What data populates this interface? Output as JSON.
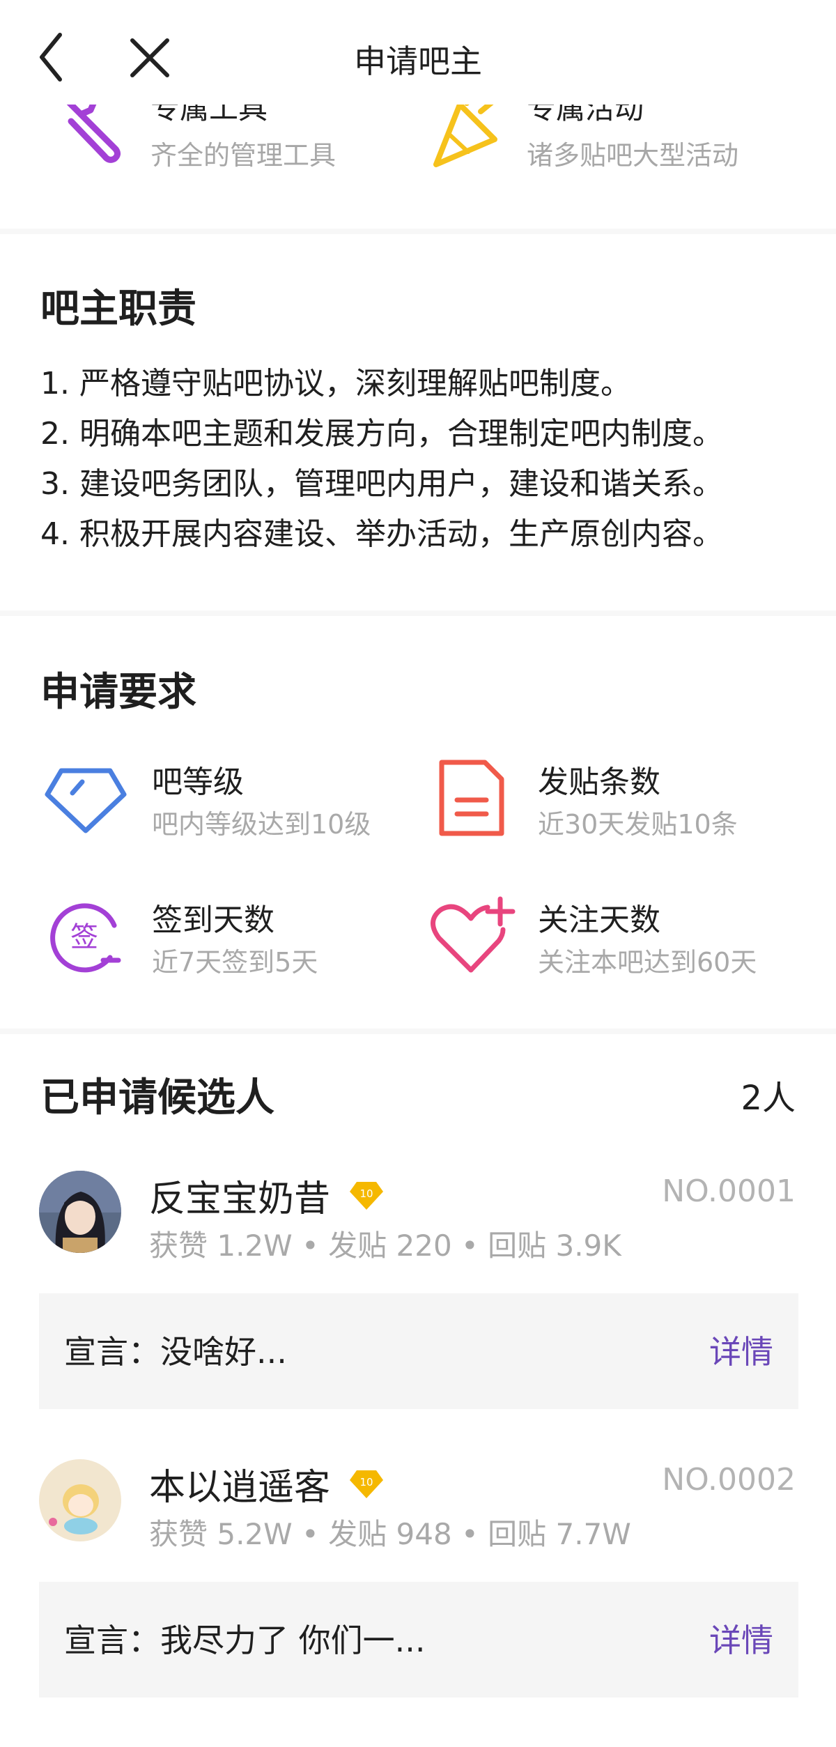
{
  "header": {
    "title": "申请吧主"
  },
  "perks": [
    {
      "title": "专属工具",
      "subtitle": "齐全的管理工具",
      "icon": "wrench-icon"
    },
    {
      "title": "专属活动",
      "subtitle": "诸多贴吧大型活动",
      "icon": "party-popper-icon"
    }
  ],
  "duties": {
    "title": "吧主职责",
    "items": [
      "1. 严格遵守贴吧协议，深刻理解贴吧制度。",
      "2. 明确本吧主题和发展方向，合理制定吧内制度。",
      "3. 建设吧务团队，管理吧内用户，建设和谐关系。",
      "4. 积极开展内容建设、举办活动，生产原创内容。"
    ]
  },
  "requirements": {
    "title": "申请要求",
    "items": [
      {
        "title": "吧等级",
        "subtitle": "吧内等级达到10级",
        "icon": "diamond-icon",
        "color": "#4a7fe0"
      },
      {
        "title": "发贴条数",
        "subtitle": "近30天发贴10条",
        "icon": "document-icon",
        "color": "#f05a4a"
      },
      {
        "title": "签到天数",
        "subtitle": "近7天签到5天",
        "icon": "sign-in-icon",
        "color": "#a340d6",
        "icon_char": "签"
      },
      {
        "title": "关注天数",
        "subtitle": "关注本吧达到60天",
        "icon": "heart-plus-icon",
        "color": "#e8457e"
      }
    ]
  },
  "candidates": {
    "title": "已申请候选人",
    "count": "2人",
    "list": [
      {
        "name": "反宝宝奶昔",
        "level": "10",
        "number": "NO.0001",
        "stats": "获赞 1.2W • 发贴 220 • 回贴 3.9K",
        "declaration": "宣言：没啥好...",
        "detail_label": "详情"
      },
      {
        "name": "本以逍遥客",
        "level": "10",
        "number": "NO.0002",
        "stats": "获赞 5.2W • 发贴 948 • 回贴 7.7W",
        "declaration": "宣言：我尽力了 你们一...",
        "detail_label": "详情"
      }
    ]
  },
  "colors": {
    "accent_purple": "#6a47b8",
    "muted_text": "#a9a9a9",
    "badge_gold": "#f5b800"
  }
}
